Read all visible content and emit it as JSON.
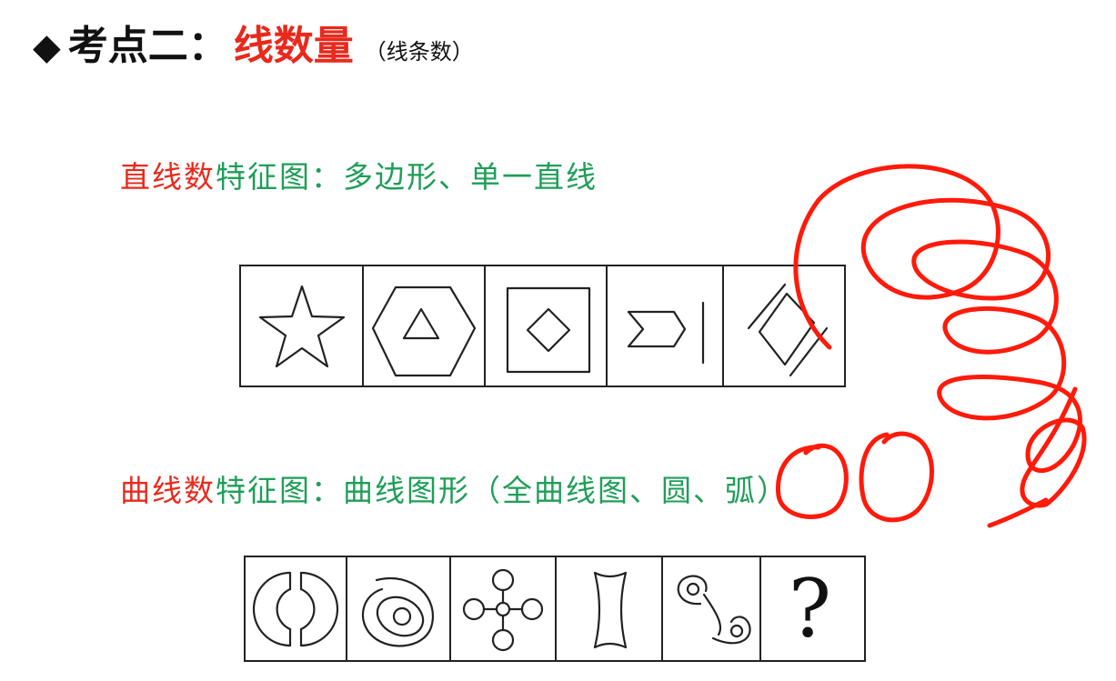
{
  "header": {
    "bullet": "◆",
    "title_prefix": "考点二：",
    "title_highlight": "线数量",
    "title_note": "（线条数）"
  },
  "straight_section": {
    "label_red": "直线数",
    "label_green": "特征图：多边形、单一直线",
    "figures": [
      "star-icon",
      "hexagon-triangle-icon",
      "square-diamond-icon",
      "arrow-line-icon",
      "diamond-lines-icon"
    ]
  },
  "curve_section": {
    "label_red": "曲线数",
    "label_green": "特征图：曲线图形（全曲线图、圆、弧）",
    "figures": [
      "split-circle-icon",
      "spiral-rings-icon",
      "flower-circles-icon",
      "concave-shape-icon",
      "swirl-circles-icon",
      "question-mark"
    ],
    "question_mark": "?"
  },
  "annotation": {
    "ink_color": "#ff1a0a"
  }
}
